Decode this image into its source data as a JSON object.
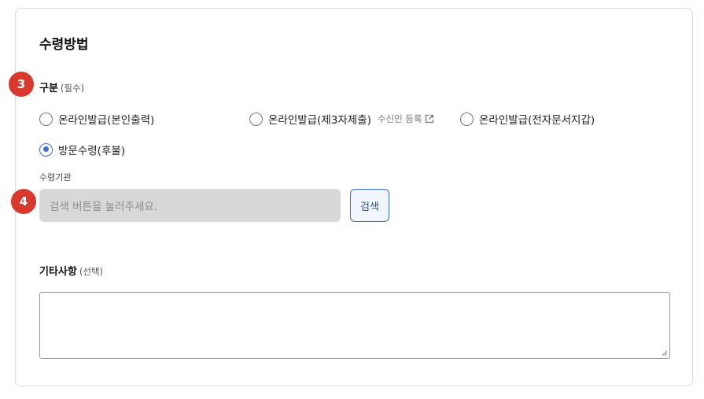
{
  "section": {
    "title": "수령방법"
  },
  "steps": {
    "step1": "3",
    "step2": "4"
  },
  "category": {
    "label": "구분",
    "required": "(필수)",
    "options": [
      {
        "label": "온라인발급(본인출력)",
        "selected": false
      },
      {
        "label": "온라인발급(제3자제출)",
        "selected": false,
        "link": "수신인 등록",
        "link_icon": "external-link-icon"
      },
      {
        "label": "온라인발급(전자문서지갑)",
        "selected": false
      },
      {
        "label": "방문수령(후불)",
        "selected": true
      }
    ]
  },
  "agency": {
    "label": "수령기관",
    "placeholder": "검색 버튼을 눌러주세요.",
    "search_button": "검색"
  },
  "notes": {
    "label": "기타사항",
    "optional": "(선택)",
    "value": ""
  },
  "colors": {
    "badge": "#d9382c",
    "accent": "#3b6fd8"
  }
}
